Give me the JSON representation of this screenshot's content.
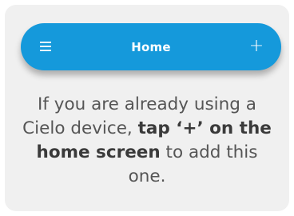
{
  "appbar": {
    "title": "Home",
    "menu_icon": "hamburger-menu-icon",
    "add_label": "+",
    "color": "#1599db"
  },
  "message": {
    "part1": "If you are already using a Cielo device, ",
    "bold": "tap ‘+’ on the home screen",
    "part2": " to add this one."
  }
}
